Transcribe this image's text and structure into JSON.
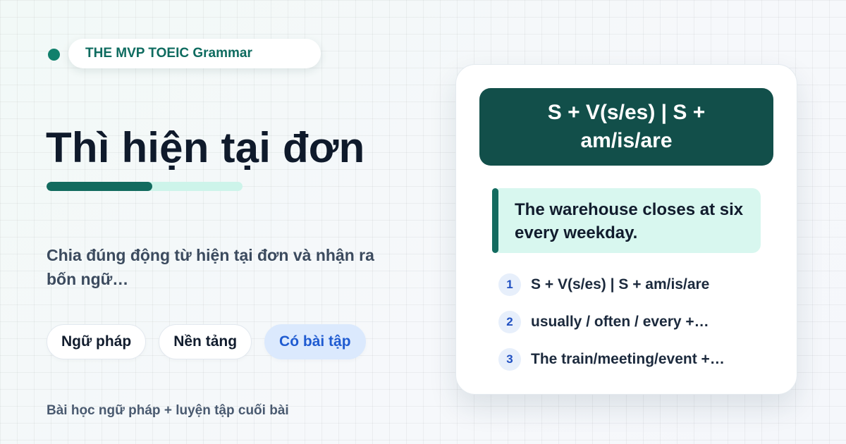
{
  "brand": {
    "label": "THE MVP TOEIC Grammar"
  },
  "hero": {
    "title": "Thì hiện tại đơn",
    "subtitle": "Chia đúng động từ hiện tại đơn và nhận ra bốn ngữ…"
  },
  "tags": [
    {
      "label": "Ngữ pháp",
      "accent": false
    },
    {
      "label": "Nền tảng",
      "accent": false
    },
    {
      "label": "Có bài tập",
      "accent": true
    }
  ],
  "footer": {
    "note": "Bài học ngữ pháp + luyện tập cuối bài"
  },
  "card": {
    "formula": "S + V(s/es) | S + am/is/are",
    "example": "The warehouse closes at six every weekday.",
    "points": [
      {
        "num": "1",
        "text": "S + V(s/es) | S + am/is/are"
      },
      {
        "num": "2",
        "text": "usually / often / every +…"
      },
      {
        "num": "3",
        "text": "The train/meeting/event +…"
      }
    ]
  },
  "colors": {
    "brand_green": "#136b5f",
    "formula_bg": "#124f4a",
    "example_bg": "#d8f7ef",
    "accent_blue": "#1f5bd1",
    "accent_blue_bg": "#dbe9fd",
    "progress_track": "#cdf4ea"
  }
}
